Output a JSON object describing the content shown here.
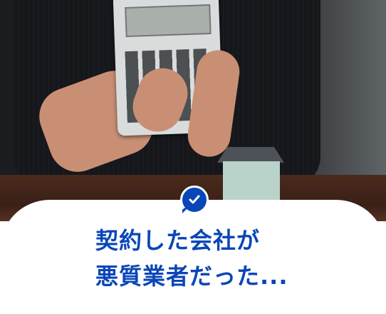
{
  "colors": {
    "accent": "#0a46b8"
  },
  "badge": {
    "icon": "check-chat-bubble-icon"
  },
  "headline": {
    "line1": "契約した会社が",
    "line2": "悪質業者だった..."
  }
}
